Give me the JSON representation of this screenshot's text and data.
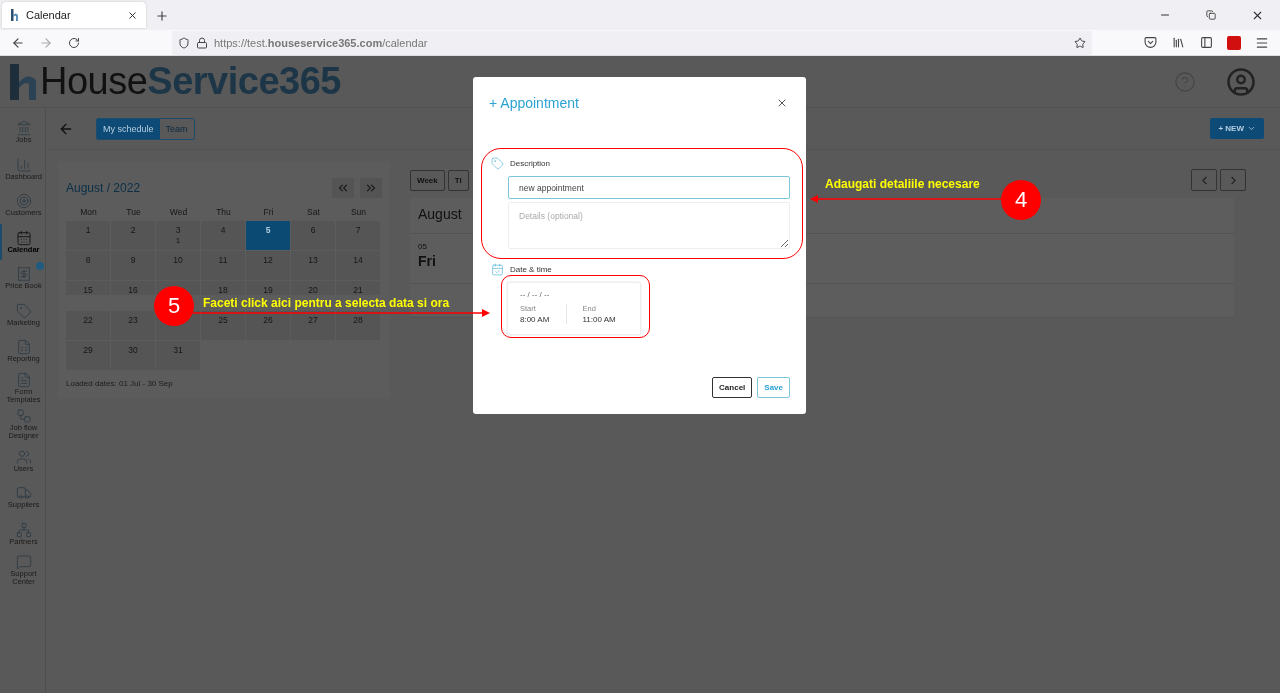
{
  "browser": {
    "tab": {
      "title": "Calendar"
    },
    "url": "https://test.**houseservice365.com**/calendar"
  },
  "logo": {
    "part1": "House",
    "part2": "Service365"
  },
  "sidebar": {
    "items": [
      {
        "label": "Jobs",
        "selected": false
      },
      {
        "label": "Dashboard",
        "selected": false
      },
      {
        "label": "Customers",
        "selected": false
      },
      {
        "label": "Calendar",
        "selected": true
      },
      {
        "label": "Price Book",
        "selected": false
      },
      {
        "label": "Marketing",
        "selected": false
      },
      {
        "label": "Reporting",
        "selected": false
      },
      {
        "label": "Form Templates",
        "selected": false
      },
      {
        "label": "Job flow Designer",
        "selected": false
      },
      {
        "label": "Users",
        "selected": false
      },
      {
        "label": "Suppliers",
        "selected": false
      },
      {
        "label": "Partners",
        "selected": false
      },
      {
        "label": "Support Center",
        "selected": false
      }
    ]
  },
  "toolbar": {
    "view_toggle": [
      {
        "label": "My schedule",
        "selected": true
      },
      {
        "label": "Team",
        "selected": false
      }
    ],
    "new_button": "+ NEW"
  },
  "calendar": {
    "title": "August / 2022",
    "weekdays": [
      "Mon",
      "Tue",
      "Wed",
      "Thu",
      "Fri",
      "Sat",
      "Sun"
    ],
    "days": [
      {
        "label": "1",
        "selected": false
      },
      {
        "label": "2",
        "selected": false
      },
      {
        "label": "3",
        "selected": false,
        "count": "1"
      },
      {
        "label": "4",
        "selected": false
      },
      {
        "label": "5",
        "selected": true
      },
      {
        "label": "6",
        "selected": false
      },
      {
        "label": "7",
        "selected": false
      },
      {
        "label": "8",
        "selected": false
      },
      {
        "label": "9",
        "selected": false
      },
      {
        "label": "10",
        "selected": false
      },
      {
        "label": "11",
        "selected": false
      },
      {
        "label": "12",
        "selected": false
      },
      {
        "label": "13",
        "selected": false
      },
      {
        "label": "14",
        "selected": false
      },
      {
        "label": "15",
        "selected": false
      },
      {
        "label": "16",
        "selected": false
      },
      {
        "selected": false
      },
      {
        "label": "18",
        "selected": false
      },
      {
        "label": "19",
        "selected": false
      },
      {
        "label": "20",
        "selected": false
      },
      {
        "label": "21",
        "selected": false
      },
      {
        "label": "22",
        "selected": false
      },
      {
        "label": "23",
        "selected": false
      },
      {
        "selected": false
      },
      {
        "label": "25",
        "selected": false
      },
      {
        "label": "26",
        "selected": false
      },
      {
        "label": "27",
        "selected": false
      },
      {
        "label": "28",
        "selected": false
      },
      {
        "label": "29",
        "selected": false
      },
      {
        "label": "30",
        "selected": false
      },
      {
        "label": "31",
        "selected": false
      }
    ],
    "loaded_dates": "Loaded dates: 01 Jul - 30 Sep"
  },
  "schedule": {
    "view_buttons": [
      "Week",
      "Ti"
    ],
    "month": "August",
    "day_number": "05",
    "day_name": "Fri"
  },
  "dialog": {
    "title": "+ Appointment",
    "description_label": "Description",
    "description_value": "new appointment",
    "details_placeholder": "Details (optional)",
    "datetime_label": "Date & time",
    "date": "-- / -- / --",
    "start_label": "Start",
    "start": "8:00 AM",
    "end_label": "End",
    "end": "11:00 AM",
    "buttons": [
      "Cancel",
      "Save"
    ]
  },
  "annotations": [
    {
      "number": "4",
      "text": "Adaugati detaliile necesare"
    },
    {
      "number": "5",
      "text": "Faceti click aici pentru a selecta data si ora"
    }
  ]
}
